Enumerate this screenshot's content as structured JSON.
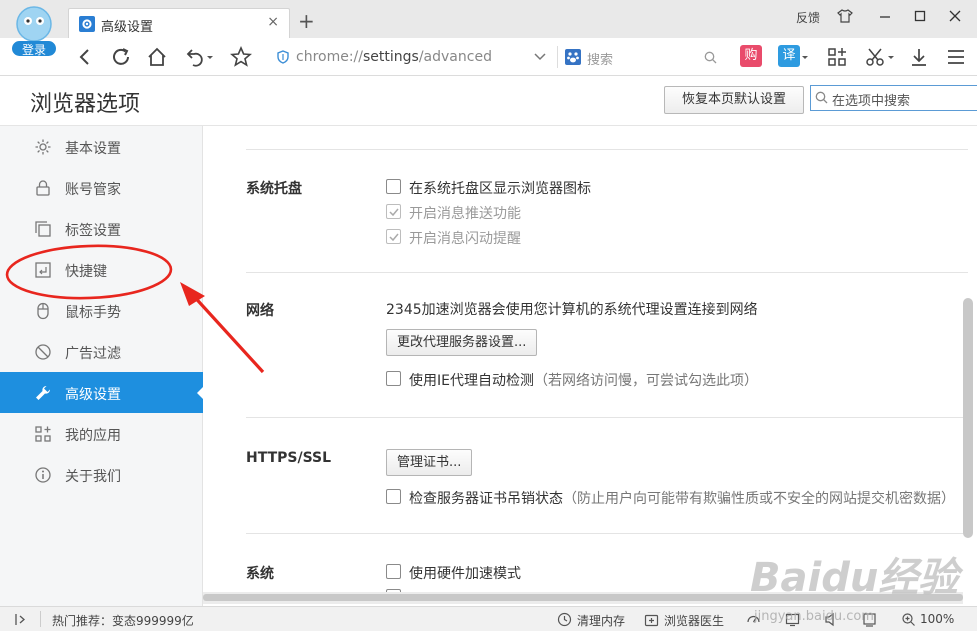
{
  "browser": {
    "login_label": "登录",
    "tab_title": "高级设置",
    "tab_close": "×",
    "new_tab": "+",
    "feedback": "反馈",
    "url_scheme": "chrome://",
    "url_host": "settings",
    "url_path": "/advanced",
    "search_placeholder": "搜索",
    "accent": "#1e8fdf"
  },
  "page": {
    "title": "浏览器选项",
    "reset_button": "恢复本页默认设置",
    "search_placeholder": "在选项中搜索"
  },
  "sidebar": {
    "items": [
      {
        "label": "基本设置",
        "icon": "gear-icon"
      },
      {
        "label": "账号管家",
        "icon": "lock-icon"
      },
      {
        "label": "标签设置",
        "icon": "tabs-icon"
      },
      {
        "label": "快捷键",
        "icon": "keyboard-icon"
      },
      {
        "label": "鼠标手势",
        "icon": "mouse-icon"
      },
      {
        "label": "广告过滤",
        "icon": "block-icon"
      },
      {
        "label": "高级设置",
        "icon": "wrench-icon",
        "active": true
      },
      {
        "label": "我的应用",
        "icon": "apps-icon"
      },
      {
        "label": "关于我们",
        "icon": "info-icon"
      }
    ]
  },
  "sections": {
    "tray": {
      "title": "系统托盘",
      "show_icon": "在系统托盘区显示浏览器图标",
      "push": "开启消息推送功能",
      "flash": "开启消息闪动提醒"
    },
    "network": {
      "title": "网络",
      "desc": "2345加速浏览器会使用您计算机的系统代理设置连接到网络",
      "proxy_button": "更改代理服务器设置...",
      "ie_proxy": "使用IE代理自动检测",
      "ie_proxy_hint": "（若网络访问慢，可尝试勾选此项）"
    },
    "https": {
      "title": "HTTPS/SSL",
      "cert_button": "管理证书...",
      "revocation": "检查服务器证书吊销状态",
      "revocation_hint": "（防止用户向可能带有欺骗性质或不安全的网站提交机密数据）"
    },
    "system": {
      "title": "系统",
      "hw_accel": "使用硬件加速模式"
    }
  },
  "statusbar": {
    "hot": "热门推荐：变态999999亿",
    "clear_memory": "清理内存",
    "doctor": "浏览器医生",
    "zoom": "100%"
  },
  "watermark": {
    "text": "Baidu经验",
    "sub": "jingyan.baidu.com"
  }
}
